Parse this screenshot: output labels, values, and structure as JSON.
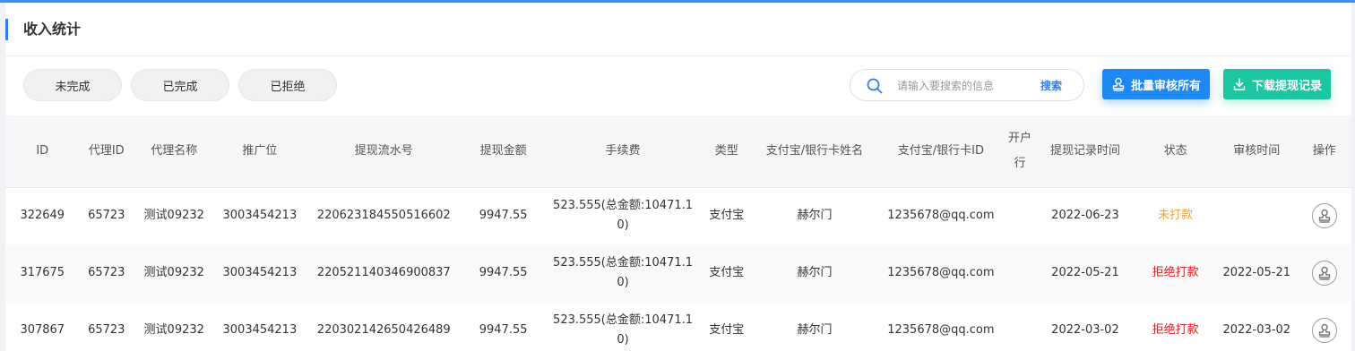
{
  "page": {
    "title": "收入统计",
    "colors": {
      "accent": "#2f7ff2",
      "audit_button": "#1e88f5",
      "download_button": "#1cc6a0",
      "pending": "#f0a040",
      "rejected": "#e02020"
    }
  },
  "filters": [
    {
      "label": "未完成"
    },
    {
      "label": "已完成"
    },
    {
      "label": "已拒绝"
    }
  ],
  "search": {
    "placeholder": "请输入要搜索的信息",
    "value": "",
    "button_label": "搜索",
    "icon": "search-icon"
  },
  "actions": {
    "audit_all_label": "批量审核所有",
    "audit_all_icon": "stamp-icon",
    "download_label": "下载提现记录",
    "download_icon": "download-icon"
  },
  "table": {
    "headers": [
      "ID",
      "代理ID",
      "代理名称",
      "推广位",
      "提现流水号",
      "提现金额",
      "手续费",
      "类型",
      "支付宝/银行卡姓名",
      "支付宝/银行卡ID",
      "开户行",
      "提现记录时间",
      "状态",
      "审核时间",
      "操作"
    ],
    "rows": [
      {
        "id": "322649",
        "agent_id": "65723",
        "agent_name": "测试09232",
        "promo": "3003454213",
        "serial": "220623184550516602",
        "amount": "9947.55",
        "fee": "523.555(总金额:10471.10)",
        "type": "支付宝",
        "account_name": "赫尔门",
        "account_id": "1235678@qq.com",
        "bank": "",
        "time": "2022-06-23",
        "status": "未打款",
        "status_kind": "pending",
        "audit_time": "",
        "op_icon": "stamp-icon"
      },
      {
        "id": "317675",
        "agent_id": "65723",
        "agent_name": "测试09232",
        "promo": "3003454213",
        "serial": "220521140346900837",
        "amount": "9947.55",
        "fee": "523.555(总金额:10471.10)",
        "type": "支付宝",
        "account_name": "赫尔门",
        "account_id": "1235678@qq.com",
        "bank": "",
        "time": "2022-05-21",
        "status": "拒绝打款",
        "status_kind": "rejected",
        "audit_time": "2022-05-21",
        "op_icon": "stamp-icon"
      },
      {
        "id": "307867",
        "agent_id": "65723",
        "agent_name": "测试09232",
        "promo": "3003454213",
        "serial": "220302142650426489",
        "amount": "9947.55",
        "fee": "523.555(总金额:10471.10)",
        "type": "支付宝",
        "account_name": "赫尔门",
        "account_id": "1235678@qq.com",
        "bank": "",
        "time": "2022-03-02",
        "status": "拒绝打款",
        "status_kind": "rejected",
        "audit_time": "2022-03-02",
        "op_icon": "stamp-icon"
      }
    ]
  }
}
